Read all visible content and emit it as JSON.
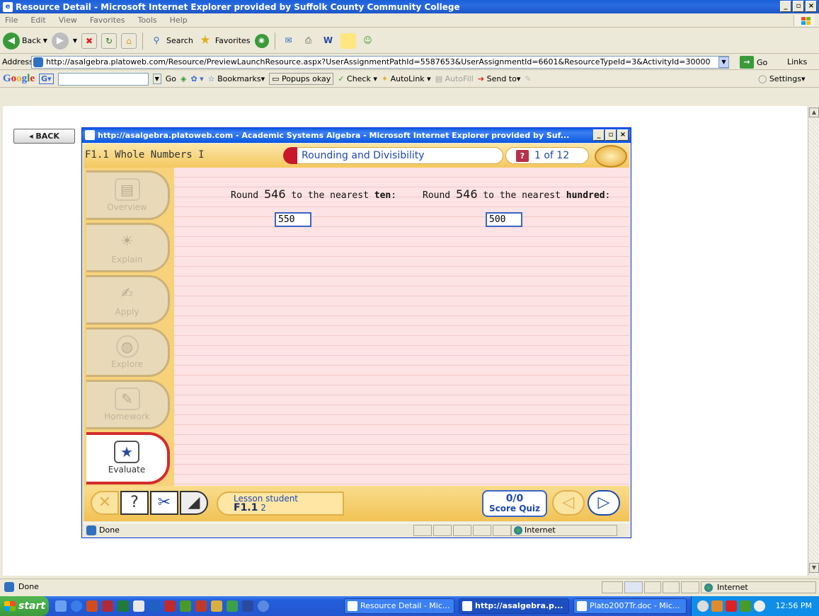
{
  "window": {
    "title": "Resource Detail - Microsoft Internet Explorer provided by Suffolk County Community College"
  },
  "menu": [
    "File",
    "Edit",
    "View",
    "Favorites",
    "Tools",
    "Help"
  ],
  "toolbar": {
    "back_label": "Back",
    "search_label": "Search",
    "favorites_label": "Favorites"
  },
  "address_bar": {
    "label": "Address",
    "url": "http://asalgebra.platoweb.com/Resource/PreviewLaunchResource.aspx?UserAssignmentPathId=5587653&UserAssignmentId=6601&ResourceTypeId=3&ActivityId=30000",
    "go_label": "Go",
    "links_label": "Links"
  },
  "google_bar": {
    "logo": "Google",
    "go_label": "Go",
    "bookmarks_label": "Bookmarks",
    "popups_label": "Popups okay",
    "check_label": "Check",
    "autolink_label": "AutoLink",
    "autofill_label": "AutoFill",
    "sendto_label": "Send to",
    "settings_label": "Settings"
  },
  "page": {
    "back_button": "◂ BACK"
  },
  "popup": {
    "title": "http://asalgebra.platoweb.com - Academic Systems Algebra - Microsoft Internet Explorer provided by Suf...",
    "lesson_title": "F1.1 Whole Numbers I",
    "topic": "Rounding and Divisibility",
    "page_indicator": "1 of 12",
    "sidebar": [
      {
        "label": "Overview",
        "icon": "book-icon",
        "active": false
      },
      {
        "label": "Explain",
        "icon": "lightbulb-icon",
        "active": false
      },
      {
        "label": "Apply",
        "icon": "hand-writing-icon",
        "active": false
      },
      {
        "label": "Explore",
        "icon": "globe-icon",
        "active": false
      },
      {
        "label": "Homework",
        "icon": "notepad-icon",
        "active": false
      },
      {
        "label": "Evaluate",
        "icon": "checklist-star-icon",
        "active": true
      }
    ],
    "question1": {
      "prefix": "Round",
      "number": "546",
      "suffix": "to the nearest",
      "unit": "ten",
      "answer": "550"
    },
    "question2": {
      "prefix": "Round",
      "number": "546",
      "suffix": "to the nearest",
      "unit": "hundred",
      "answer": "500"
    },
    "footer": {
      "lesson_label": "Lesson",
      "lesson_value": "F1.1",
      "student_label": "student",
      "student_value": "2",
      "score_symbol": "0/0",
      "score_label": "Score Quiz"
    },
    "status": "Done",
    "zone": "Internet"
  },
  "status_bar": {
    "text": "Done",
    "zone": "Internet"
  },
  "taskbar": {
    "start": "start",
    "tasks": [
      {
        "label": "Resource Detail - Mic...",
        "active": false
      },
      {
        "label": "http://asalgebra.p...",
        "active": true
      },
      {
        "label": "Plato2007Tr.doc - Mic...",
        "active": false
      }
    ],
    "clock": "12:56 PM"
  },
  "colors": {
    "xp_blue": "#245edb",
    "plato_gold": "#f4c860",
    "work_pink": "#fde3e3",
    "active_red": "#d22c2c",
    "link_blue": "#2048b0"
  }
}
